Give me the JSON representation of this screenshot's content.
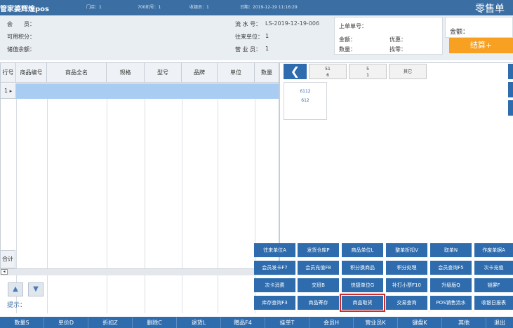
{
  "titlebar": {
    "app_name": "管家婆辉煌pos",
    "store": "门店：1",
    "pos_no": "700机号：1",
    "cashier": "收银员：1",
    "date": "日期：2019-12-19 11:16:29",
    "doc_type": "零售单"
  },
  "info": {
    "member": "会　　员：",
    "points": "可用积分：",
    "balance": "储值余额：",
    "serial_label": "流 水 号：",
    "serial_value": "LS-2019-12-19-006",
    "unit_label": "往来单位：",
    "unit_value": "1",
    "sales_label": "营 业 员：",
    "sales_value": "1",
    "prev_doc": "上单单号：",
    "amount": "金额：",
    "discount": "优惠：",
    "quantity": "数量：",
    "change": "找零：",
    "total_label": "金额：",
    "settle_button": "结算+"
  },
  "grid": {
    "headers": [
      "行号",
      "商品编号",
      "商品全名",
      "规格",
      "型号",
      "品牌",
      "单位",
      "数量"
    ],
    "row_number": "1",
    "row_marker": "▸",
    "sum_label": "合计",
    "scroll_left": "◂"
  },
  "nav": {
    "up": "▲",
    "down": "▼",
    "hint": "提示："
  },
  "right_panel": {
    "back_icon": "back-arrow-icon",
    "back_glyph": "❮",
    "category_tabs": [
      {
        "line1": "51",
        "line2": "6"
      },
      {
        "line1": "5",
        "line2": "1"
      },
      {
        "line1": "其它",
        "line2": ""
      }
    ],
    "product": {
      "line1": "6112",
      "line2": "612"
    }
  },
  "function_buttons": [
    [
      "往来单位A",
      "发货仓库P",
      "商品单位L",
      "整单折扣V",
      "取单N",
      "作废单据A"
    ],
    [
      "会员发卡F7",
      "会员充值F8",
      "积分换商品",
      "积分处理",
      "会员查询F5",
      "次卡充值"
    ],
    [
      "次卡消费",
      "交班B",
      "快捷单位G",
      "补打小票F10",
      "升级版Q",
      "锁屏F"
    ],
    [
      "库存查询F3",
      "商品寄存",
      "商品取货",
      "交易查询",
      "POS销售流水",
      "收银日报表"
    ]
  ],
  "highlighted_button": "商品取货",
  "bottom_buttons": [
    "数量S",
    "单价D",
    "折扣Z",
    "删除C",
    "退货L",
    "赠品F4",
    "挂单T",
    "会员H",
    "营业员K",
    "键盘K",
    "其他",
    "退出"
  ],
  "colors": {
    "primary": "#2e6cae",
    "titlebar": "#3b6fa3",
    "accent": "#f7a021",
    "selected_row": "#a9cdf2",
    "highlight_border": "#d12b2b"
  }
}
